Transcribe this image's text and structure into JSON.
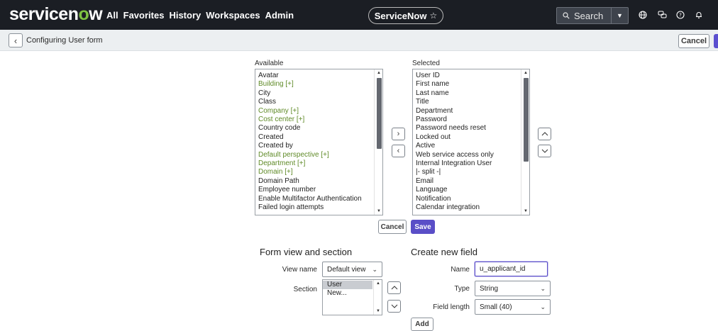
{
  "topbar": {
    "logo_pre": "servicen",
    "logo_o": "o",
    "logo_post": "w",
    "nav": [
      "All",
      "Favorites",
      "History",
      "Workspaces",
      "Admin"
    ],
    "instance": "ServiceNow",
    "search_placeholder": "Search"
  },
  "subbar": {
    "title": "Configuring User form",
    "cancel": "Cancel"
  },
  "slush": {
    "available_label": "Available",
    "selected_label": "Selected",
    "available": [
      {
        "text": "Avatar",
        "ref": false
      },
      {
        "text": "Building [+]",
        "ref": true
      },
      {
        "text": "City",
        "ref": false
      },
      {
        "text": "Class",
        "ref": false
      },
      {
        "text": "Company [+]",
        "ref": true
      },
      {
        "text": "Cost center [+]",
        "ref": true
      },
      {
        "text": "Country code",
        "ref": false
      },
      {
        "text": "Created",
        "ref": false
      },
      {
        "text": "Created by",
        "ref": false
      },
      {
        "text": "Default perspective [+]",
        "ref": true
      },
      {
        "text": "Department [+]",
        "ref": true
      },
      {
        "text": "Domain [+]",
        "ref": true
      },
      {
        "text": "Domain Path",
        "ref": false
      },
      {
        "text": "Employee number",
        "ref": false
      },
      {
        "text": "Enable Multifactor Authentication",
        "ref": false
      },
      {
        "text": "Failed login attempts",
        "ref": false
      }
    ],
    "selected": [
      "User ID",
      "First name",
      "Last name",
      "Title",
      "Department",
      "Password",
      "Password needs reset",
      "Locked out",
      "Active",
      "Web service access only",
      "Internal Integration User",
      "|- split -|",
      "Email",
      "Language",
      "Notification",
      "Calendar integration"
    ],
    "cancel": "Cancel",
    "save": "Save"
  },
  "form_view": {
    "title": "Form view and section",
    "view_label": "View name",
    "view_value": "Default view",
    "section_label": "Section",
    "sections": [
      "User",
      "New..."
    ]
  },
  "new_field": {
    "title": "Create new field",
    "name_label": "Name",
    "name_value": "u_applicant_id",
    "type_label": "Type",
    "type_value": "String",
    "length_label": "Field length",
    "length_value": "Small (40)",
    "add": "Add"
  }
}
